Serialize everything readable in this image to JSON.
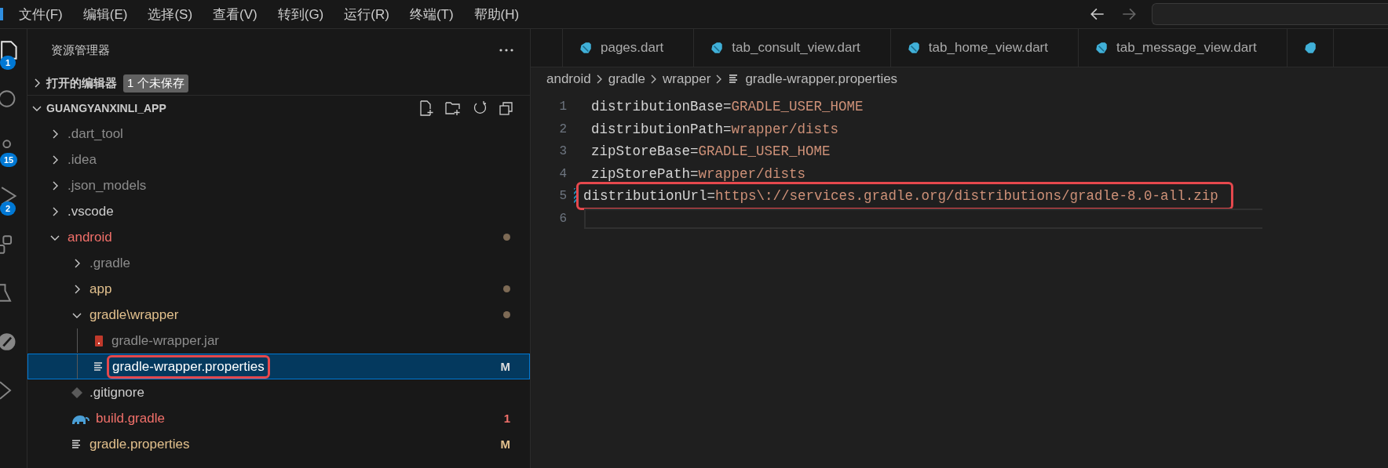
{
  "menu": [
    "文件(F)",
    "编辑(E)",
    "选择(S)",
    "查看(V)",
    "转到(G)",
    "运行(R)",
    "终端(T)",
    "帮助(H)"
  ],
  "activity": [
    {
      "kind": "files",
      "selected": true,
      "badge": "1"
    },
    {
      "kind": "search",
      "selected": false
    },
    {
      "kind": "source-control",
      "selected": false,
      "badge": "15"
    },
    {
      "kind": "run",
      "selected": false,
      "badge": "2"
    },
    {
      "kind": "extensions",
      "selected": false
    },
    {
      "kind": "testing",
      "selected": false
    },
    {
      "kind": "remote",
      "selected": false
    },
    {
      "kind": "flutter",
      "selected": false
    }
  ],
  "sidebar": {
    "title": "资源管理器",
    "open_editors": {
      "label": "打开的编辑器",
      "badge": "1 个未保存",
      "expanded": false
    },
    "project": {
      "label": "GUANGYANXINLI_APP",
      "expanded": true
    },
    "tree": [
      {
        "label": ".dart_tool",
        "kind": "folder",
        "expanded": false,
        "color": "#8c8c8c",
        "dot": false
      },
      {
        "label": ".idea",
        "kind": "folder",
        "expanded": false,
        "color": "#8c8c8c",
        "dot": false
      },
      {
        "label": ".json_models",
        "kind": "folder",
        "expanded": false,
        "color": "#8c8c8c",
        "dot": false
      },
      {
        "label": ".vscode",
        "kind": "folder",
        "expanded": false,
        "color": "#cccccc",
        "dot": false
      },
      {
        "label": "android",
        "kind": "folder",
        "expanded": true,
        "color": "#f1706a",
        "dot": true,
        "children": [
          {
            "label": ".gradle",
            "kind": "folder",
            "expanded": false,
            "color": "#8c8c8c",
            "dot": false
          },
          {
            "label": "app",
            "kind": "folder",
            "expanded": false,
            "color": "#e2c08d",
            "dot": true
          },
          {
            "label": "gradle\\wrapper",
            "kind": "folder",
            "expanded": true,
            "color": "#e2c08d",
            "dot": true,
            "children": [
              {
                "label": "gradle-wrapper.jar",
                "kind": "jar",
                "color": "#8c8c8c",
                "selected": false,
                "annotated": false
              },
              {
                "label": "gradle-wrapper.properties",
                "kind": "properties",
                "color": "#ffffff",
                "selected": true,
                "annotated": true,
                "badge": "M"
              }
            ]
          },
          {
            "label": ".gitignore",
            "kind": "git",
            "color": "#cccccc",
            "selected": false,
            "annotated": false
          },
          {
            "label": "build.gradle",
            "kind": "gradle",
            "color": "#f1706a",
            "selected": false,
            "annotated": false,
            "badge": "1"
          },
          {
            "label": "gradle.properties",
            "kind": "properties",
            "color": "#e2c08d",
            "selected": false,
            "annotated": false,
            "badge": "M"
          }
        ]
      }
    ]
  },
  "tabs": [
    {
      "label": "pages.dart",
      "selected": false
    },
    {
      "label": "tab_consult_view.dart",
      "selected": false
    },
    {
      "label": "tab_home_view.dart",
      "selected": false
    },
    {
      "label": "tab_message_view.dart",
      "selected": false
    }
  ],
  "breadcrumb": [
    "android",
    "gradle",
    "wrapper",
    "gradle-wrapper.properties"
  ],
  "code": [
    {
      "number": "1",
      "key": "distributionBase=",
      "value": "GRADLE_USER_HOME",
      "modified": false,
      "annotated": false,
      "current": false
    },
    {
      "number": "2",
      "key": "distributionPath=",
      "value": "wrapper/dists",
      "modified": false,
      "annotated": false,
      "current": false
    },
    {
      "number": "3",
      "key": "zipStoreBase=",
      "value": "GRADLE_USER_HOME",
      "modified": false,
      "annotated": false,
      "current": false
    },
    {
      "number": "4",
      "key": "zipStorePath=",
      "value": "wrapper/dists",
      "modified": false,
      "annotated": false,
      "current": false
    },
    {
      "number": "5",
      "key": "distributionUrl=",
      "value": "https\\://services.gradle.org/distributions/gradle-8.0-all.zip",
      "modified": true,
      "annotated": true,
      "current": false
    },
    {
      "number": "6",
      "modified": false,
      "annotated": false,
      "current": true
    }
  ]
}
